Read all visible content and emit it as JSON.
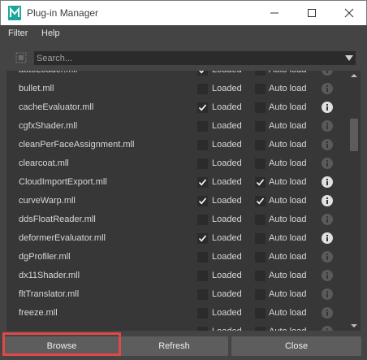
{
  "window": {
    "title": "Plug-in Manager"
  },
  "menu": {
    "items": [
      "Filter",
      "Help"
    ]
  },
  "search": {
    "placeholder": "Search..."
  },
  "labels": {
    "loaded": "Loaded",
    "auto_load": "Auto load"
  },
  "plugins": [
    {
      "name": "autoLoader.mll",
      "loaded": true,
      "auto_load": false,
      "info_active": false
    },
    {
      "name": "bullet.mll",
      "loaded": false,
      "auto_load": false,
      "info_active": false
    },
    {
      "name": "cacheEvaluator.mll",
      "loaded": true,
      "auto_load": false,
      "info_active": true
    },
    {
      "name": "cgfxShader.mll",
      "loaded": false,
      "auto_load": false,
      "info_active": false
    },
    {
      "name": "cleanPerFaceAssignment.mll",
      "loaded": false,
      "auto_load": false,
      "info_active": false
    },
    {
      "name": "clearcoat.mll",
      "loaded": false,
      "auto_load": false,
      "info_active": false
    },
    {
      "name": "CloudImportExport.mll",
      "loaded": true,
      "auto_load": true,
      "info_active": true
    },
    {
      "name": "curveWarp.mll",
      "loaded": true,
      "auto_load": true,
      "info_active": true
    },
    {
      "name": "ddsFloatReader.mll",
      "loaded": false,
      "auto_load": false,
      "info_active": false
    },
    {
      "name": "deformerEvaluator.mll",
      "loaded": true,
      "auto_load": false,
      "info_active": true
    },
    {
      "name": "dgProfiler.mll",
      "loaded": false,
      "auto_load": false,
      "info_active": false
    },
    {
      "name": "dx11Shader.mll",
      "loaded": false,
      "auto_load": false,
      "info_active": false
    },
    {
      "name": "fltTranslator.mll",
      "loaded": false,
      "auto_load": false,
      "info_active": false
    },
    {
      "name": "freeze.mll",
      "loaded": false,
      "auto_load": false,
      "info_active": false
    },
    {
      "name": "",
      "loaded": false,
      "auto_load": false,
      "info_active": false
    }
  ],
  "buttons": {
    "browse": "Browse",
    "refresh": "Refresh",
    "close": "Close"
  },
  "colors": {
    "highlight": "#e24848",
    "app_icon": "#1ba89c"
  }
}
